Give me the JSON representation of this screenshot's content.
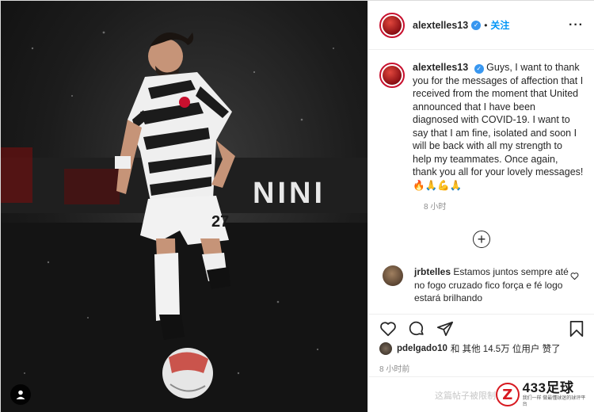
{
  "header": {
    "username": "alextelles13",
    "verified_mark": "✓",
    "separator": "•",
    "follow_label": "关注",
    "more_label": "···"
  },
  "caption": {
    "username": "alextelles13",
    "text": "Guys, I want to thank you for the messages of affection that I received from the moment that United announced that I have been diagnosed with COVID-19. I want to say that I am fine, isolated and soon I will be back with all my strength to help my teammates. Once again, thank you all for your lovely messages! 🔥🙏💪🙏",
    "time_ago": "8 小时"
  },
  "load_more": {
    "label": "+"
  },
  "comment": {
    "username": "jrbtelles",
    "text": "Estamos juntos sempre até no fogo cruzado fico força e fé logo estará brilhando"
  },
  "actions": {
    "like": "heart-icon",
    "comment": "comment-icon",
    "share": "share-icon",
    "save": "bookmark-icon"
  },
  "likes": {
    "first_user": "pdelgado10",
    "text": "和 其他 14.5万 位用户 赞了"
  },
  "post_time": "8 小时前",
  "comment_input": {
    "placeholder": "这篇帖子被限制..."
  },
  "media": {
    "jersey_number": "27",
    "board_text": "NINI"
  },
  "watermark": {
    "logo_letter": "Z",
    "brand": "433足球",
    "tagline": "我们一样 做最懂球迷的球评平台"
  },
  "colors": {
    "accent_blue": "#0095f6",
    "verified_blue": "#3897f0",
    "muted_text": "#8e8e8e",
    "brand_red": "#d71920"
  }
}
